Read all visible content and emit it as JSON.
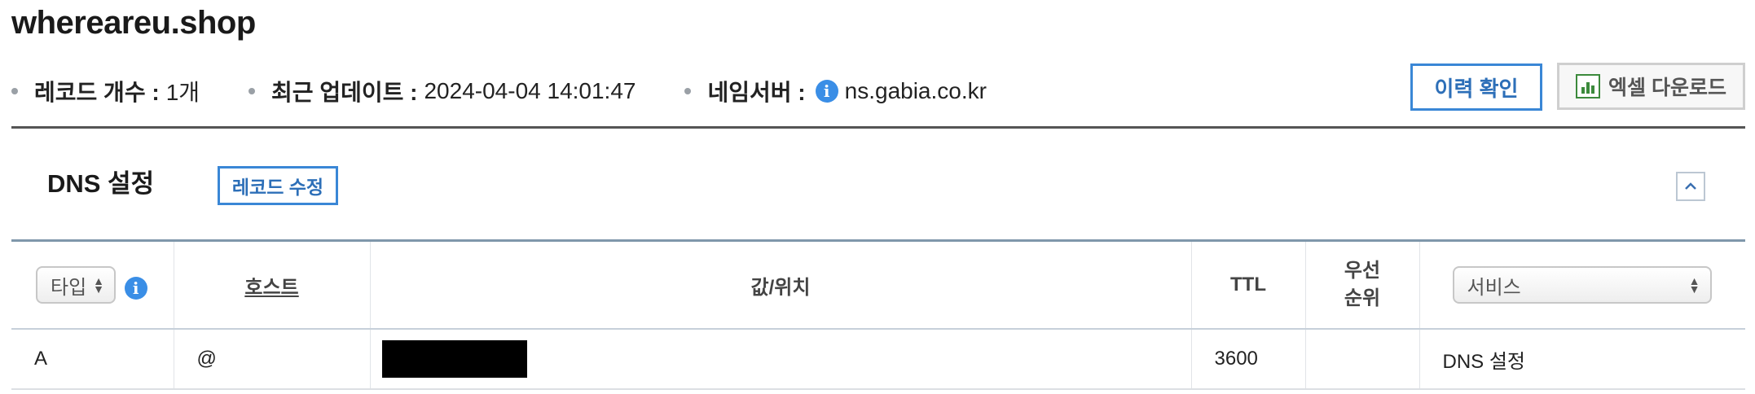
{
  "domain": {
    "name": "whereareu.shop"
  },
  "meta": {
    "record_count_label": "레코드 개수 :",
    "record_count_value": "1개",
    "last_update_label": "최근 업데이트 :",
    "last_update_value": "2024-04-04 14:01:47",
    "nameserver_label": "네임서버 :",
    "nameserver_value": "ns.gabia.co.kr"
  },
  "toolbar": {
    "history_label": "이력 확인",
    "excel_label": "엑셀 다운로드"
  },
  "dns": {
    "title": "DNS 설정",
    "edit_label": "레코드 수정"
  },
  "table": {
    "type_select": "타입",
    "columns": {
      "host": "호스트",
      "value": "값/위치",
      "ttl": "TTL",
      "priority_line1": "우선",
      "priority_line2": "순위"
    },
    "service_select": "서비스",
    "rows": [
      {
        "type": "A",
        "host": "@",
        "value": "",
        "ttl": "3600",
        "priority": "",
        "service": "DNS 설정"
      }
    ]
  },
  "colors": {
    "accent": "#3a87d6",
    "info_icon": "#3a8ee6",
    "excel_green": "#3c8a3c"
  },
  "icons": {
    "info": "info-icon",
    "excel": "excel-icon",
    "collapse": "chevron-up-icon"
  }
}
